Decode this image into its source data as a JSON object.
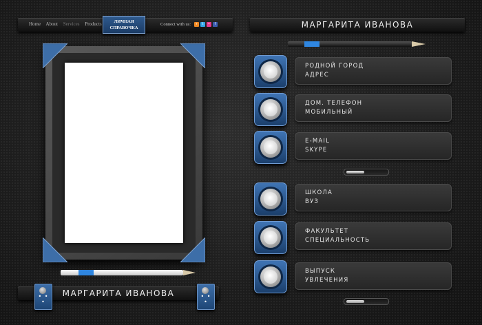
{
  "nav": {
    "links": [
      "Home",
      "About",
      "Services",
      "Products"
    ],
    "logo_line1": "ЛИЧНАЯ",
    "logo_line2": "СПРАВОЧКА",
    "connect": "Connect with us:",
    "social": [
      {
        "name": "rss-icon",
        "glyph": "r",
        "color": "#f08a24"
      },
      {
        "name": "twitter-icon",
        "glyph": "t",
        "color": "#35a6e8"
      },
      {
        "name": "flickr-icon",
        "glyph": "•",
        "color": "#e83a8c"
      },
      {
        "name": "facebook-icon",
        "glyph": "f",
        "color": "#3b5db0"
      }
    ]
  },
  "header_name": "МАРГАРИТА ИВАНОВА",
  "footer_name": "МАРГАРИТА ИВАНОВА",
  "rows": [
    {
      "line1": "РОДНОЙ ГОРОД",
      "line2": "АДРЕС"
    },
    {
      "line1": "ДОМ. ТЕЛЕФОН",
      "line2": "МОБИЛЬНЫЙ"
    },
    {
      "line1": "E-MAIL",
      "line2": "SKYPE"
    },
    {
      "line1": "ШКОЛА",
      "line2": "ВУЗ"
    },
    {
      "line1": "ФАКУЛЬТЕТ",
      "line2": "СПЕЦИАЛЬНОСТЬ"
    },
    {
      "line1": "ВЫПУСК",
      "line2": "УВЛЕЧЕНИЯ"
    }
  ],
  "clip_dots": "• • •",
  "colors": {
    "accent": "#2f86e0",
    "panel": "#2a2a2a"
  }
}
